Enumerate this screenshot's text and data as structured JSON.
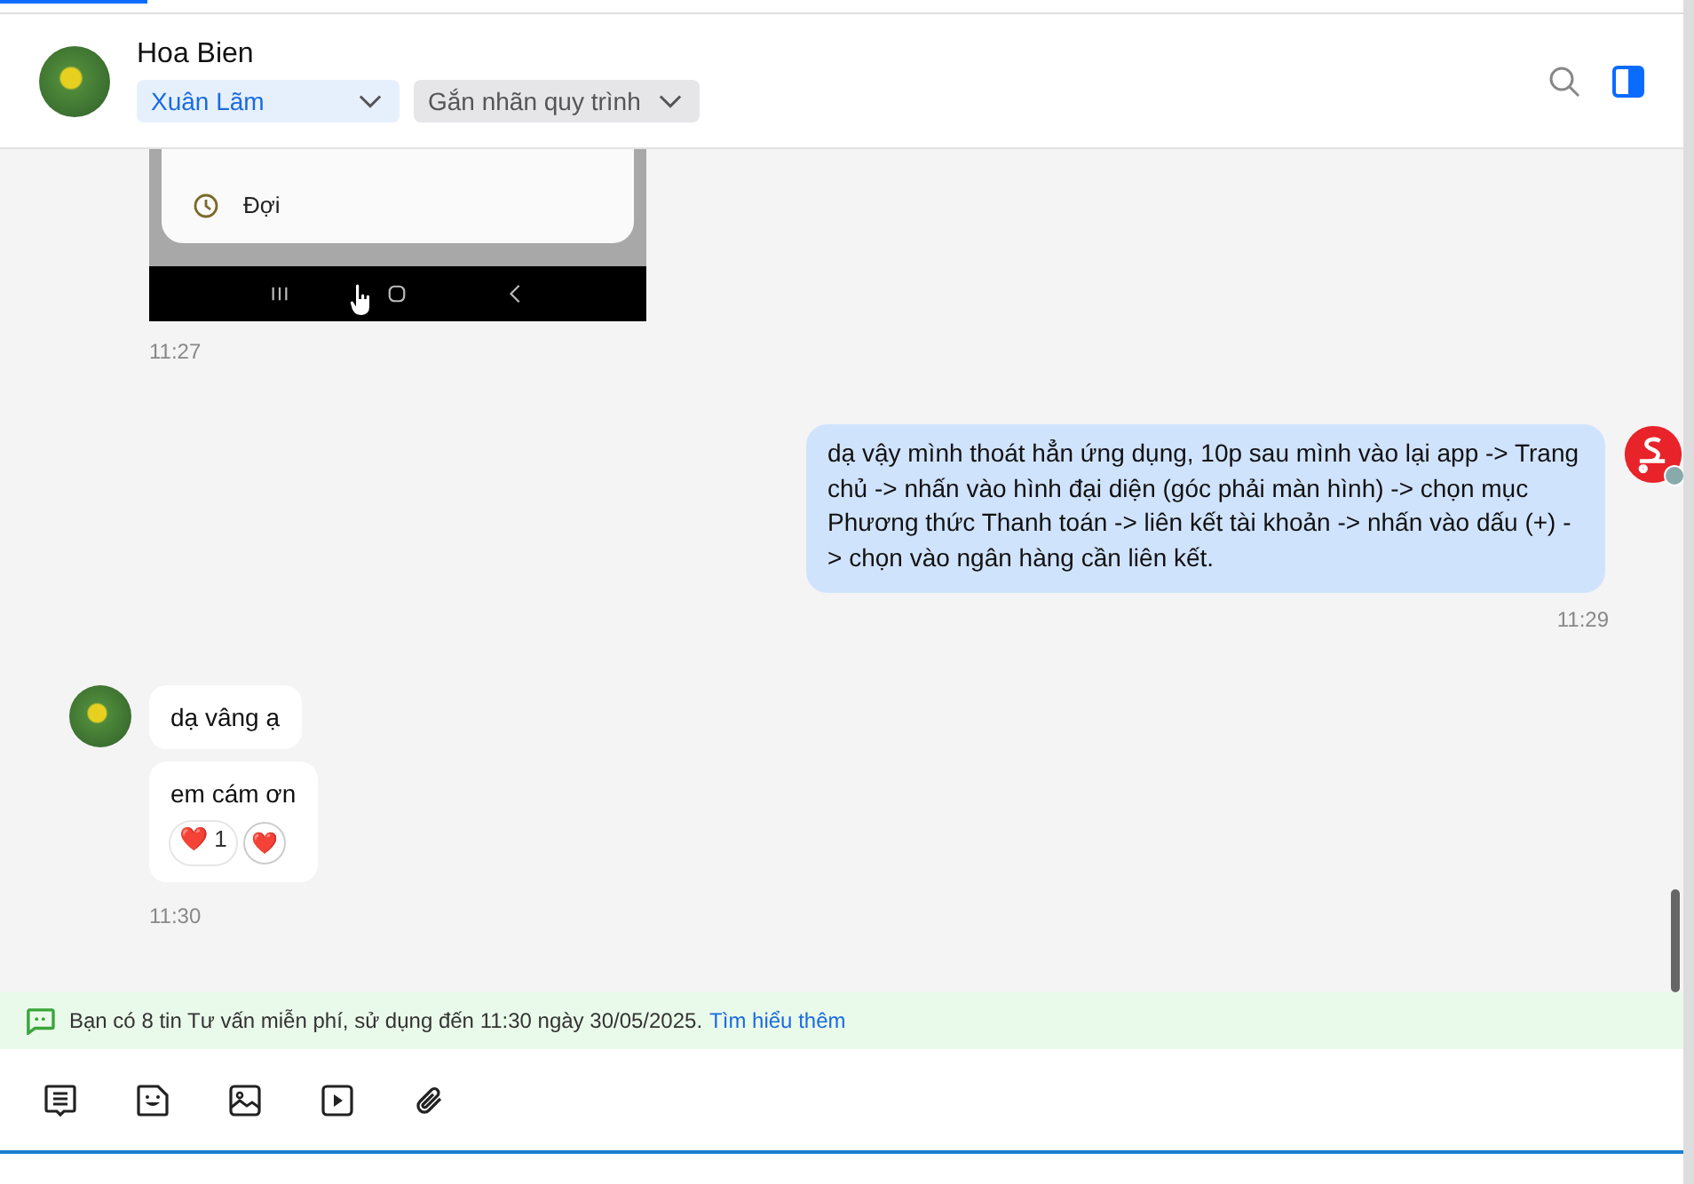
{
  "header": {
    "name": "Hoa Bien",
    "assignee": "Xuân Lãm",
    "label_picker": "Gắn nhãn quy trình"
  },
  "messages": [
    {
      "kind": "image",
      "menu_item": "Đợi",
      "time": "11:27"
    },
    {
      "kind": "text",
      "text": "dạ vậy mình thoát hẳn ứng dụng, 10p sau mình vào lại app -> Trang chủ -> nhấn vào hình đại diện (góc phải màn hình) -> chọn mục Phương thức Thanh toán -> liên kết tài khoản -> nhấn vào dấu (+) -> chọn vào ngân hàng cần liên kết.",
      "time": "11:29"
    },
    {
      "kind": "group",
      "bubbles": [
        {
          "text": "dạ vâng ạ"
        },
        {
          "text": "em cám ơn",
          "reaction": {
            "emoji": "❤️",
            "count": "1"
          },
          "react_button": "❤️"
        }
      ],
      "time": "11:30"
    }
  ],
  "banner": {
    "text": "Bạn có 8 tin Tư vấn miễn phí, sử dụng đến 11:30 ngày 30/05/2025.",
    "link": "Tìm hiểu thêm"
  }
}
